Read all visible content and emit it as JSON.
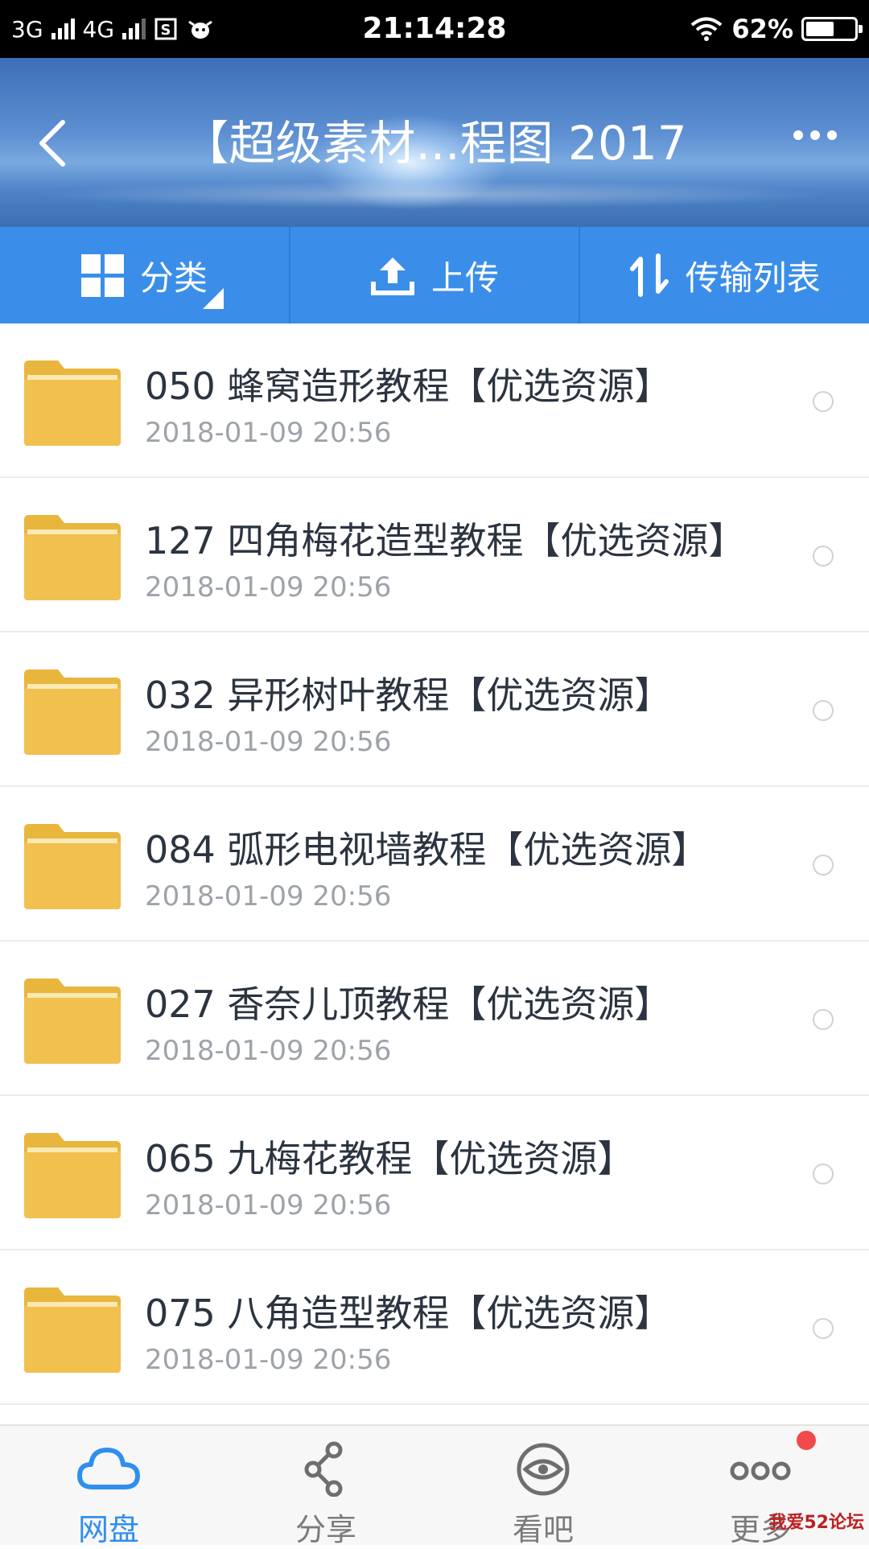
{
  "status_bar": {
    "network_1": "3G",
    "network_2": "4G",
    "time": "21:14:28",
    "battery": "62%",
    "battery_level": 0.62
  },
  "header": {
    "title": "【超级素材...程图 2017"
  },
  "toolbar": {
    "category_label": "分类",
    "upload_label": "上传",
    "transfer_label": "传输列表"
  },
  "files": [
    {
      "name": "050 蜂窝造形教程【优选资源】",
      "date": "2018-01-09  20:56"
    },
    {
      "name": "127 四角梅花造型教程【优选资源】",
      "date": "2018-01-09  20:56"
    },
    {
      "name": "032 异形树叶教程【优选资源】",
      "date": "2018-01-09  20:56"
    },
    {
      "name": "084 弧形电视墙教程【优选资源】",
      "date": "2018-01-09  20:56"
    },
    {
      "name": "027 香奈儿顶教程【优选资源】",
      "date": "2018-01-09  20:56"
    },
    {
      "name": "065 九梅花教程【优选资源】",
      "date": "2018-01-09  20:56"
    },
    {
      "name": "075 八角造型教程【优选资源】",
      "date": "2018-01-09  20:56"
    }
  ],
  "bottom_nav": [
    {
      "label": "网盘",
      "icon": "cloud-icon",
      "active": true
    },
    {
      "label": "分享",
      "icon": "share-icon",
      "active": false
    },
    {
      "label": "看吧",
      "icon": "eye-icon",
      "active": false
    },
    {
      "label": "更多",
      "icon": "more-icon",
      "active": false
    }
  ],
  "watermark": "我爱52论坛",
  "colors": {
    "accent": "#3a8ee9",
    "active_nav": "#2f8fee",
    "folder": "#f1c04f",
    "badge": "#f04a4a"
  }
}
